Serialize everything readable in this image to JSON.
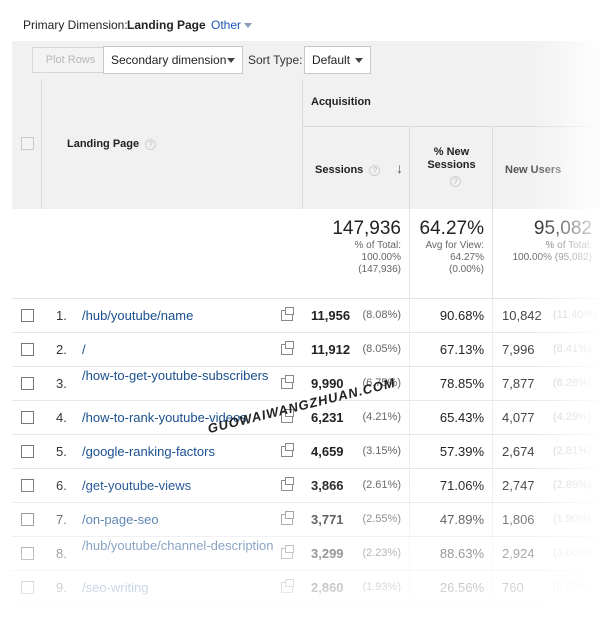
{
  "primary_dimension": {
    "label": "Primary Dimension:",
    "value": "Landing Page",
    "other": "Other"
  },
  "toolbar": {
    "plot_rows": "Plot Rows",
    "secondary_dimension": "Secondary dimension",
    "sort_type_label": "Sort Type:",
    "sort_type_value": "Default"
  },
  "table": {
    "landing_page_header": "Landing Page",
    "acquisition_header": "Acquisition",
    "sessions_header": "Sessions",
    "new_sessions_header": "% New Sessions",
    "new_users_header": "New Users",
    "help_glyph": "?",
    "sort_arrow": "↓",
    "totals": {
      "sessions": "147,936",
      "sessions_pct_line1": "% of Total:",
      "sessions_pct_line2": "100.00%",
      "sessions_pct_line3": "(147,936)",
      "new_sessions": "64.27%",
      "new_sessions_line1": "Avg for View:",
      "new_sessions_line2": "64.27%",
      "new_sessions_line3": "(0.00%)",
      "new_users": "95,082",
      "new_users_line1": "% of Total:",
      "new_users_line2": "100.00% (95,082)"
    },
    "rows": [
      {
        "num": "1.",
        "page": "/hub/youtube/name",
        "sessions": "11,956",
        "sessions_pct": "(8.08%)",
        "new_sessions": "90.68%",
        "new_users": "10,842",
        "new_users_pct": "(11.40%)"
      },
      {
        "num": "2.",
        "page": "/",
        "sessions": "11,912",
        "sessions_pct": "(8.05%)",
        "new_sessions": "67.13%",
        "new_users": "7,996",
        "new_users_pct": "(8.41%)"
      },
      {
        "num": "3.",
        "page": "/how-to-get-youtube-subscribers",
        "sessions": "9,990",
        "sessions_pct": "(6.75%)",
        "new_sessions": "78.85%",
        "new_users": "7,877",
        "new_users_pct": "(8.28%)"
      },
      {
        "num": "4.",
        "page": "/how-to-rank-youtube-videos",
        "sessions": "6,231",
        "sessions_pct": "(4.21%)",
        "new_sessions": "65.43%",
        "new_users": "4,077",
        "new_users_pct": "(4.29%)"
      },
      {
        "num": "5.",
        "page": "/google-ranking-factors",
        "sessions": "4,659",
        "sessions_pct": "(3.15%)",
        "new_sessions": "57.39%",
        "new_users": "2,674",
        "new_users_pct": "(2.81%)"
      },
      {
        "num": "6.",
        "page": "/get-youtube-views",
        "sessions": "3,866",
        "sessions_pct": "(2.61%)",
        "new_sessions": "71.06%",
        "new_users": "2,747",
        "new_users_pct": "(2.89%)"
      },
      {
        "num": "7.",
        "page": "/on-page-seo",
        "sessions": "3,771",
        "sessions_pct": "(2.55%)",
        "new_sessions": "47.89%",
        "new_users": "1,806",
        "new_users_pct": "(1.90%)"
      },
      {
        "num": "8.",
        "page": "/hub/youtube/channel-description",
        "sessions": "3,299",
        "sessions_pct": "(2.23%)",
        "new_sessions": "88.63%",
        "new_users": "2,924",
        "new_users_pct": "(3.08%)"
      },
      {
        "num": "9.",
        "page": "/seo-writing",
        "sessions": "2,860",
        "sessions_pct": "(1.93%)",
        "new_sessions": "26.56%",
        "new_users": "760",
        "new_users_pct": "(0.80%)"
      }
    ]
  },
  "watermark": "GUOWAIWANGZHUAN.COM"
}
